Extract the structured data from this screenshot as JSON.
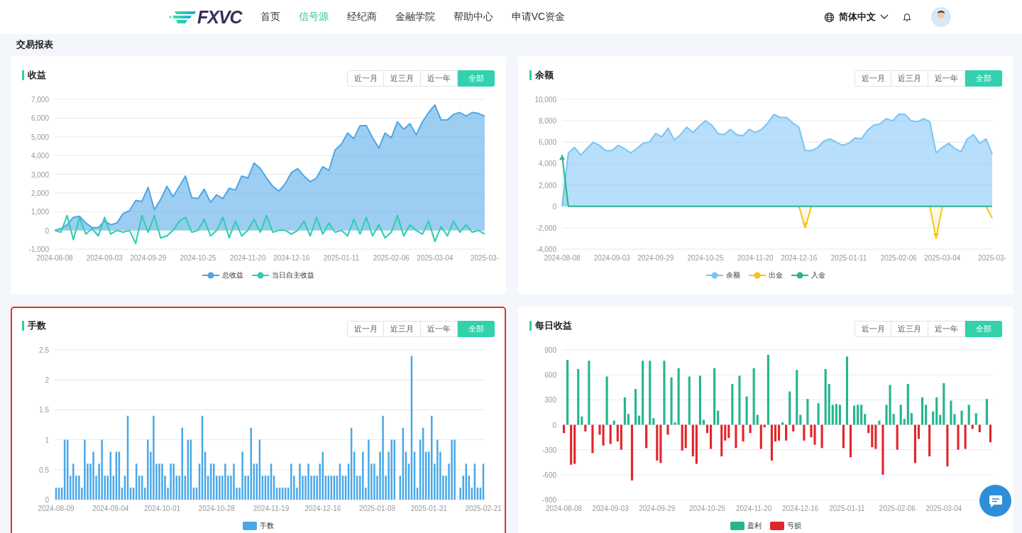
{
  "header": {
    "logo": "FXVC",
    "nav": [
      {
        "label": "首页",
        "selected": false
      },
      {
        "label": "信号源",
        "selected": true
      },
      {
        "label": "经纪商",
        "selected": false
      },
      {
        "label": "金融学院",
        "selected": false
      },
      {
        "label": "帮助中心",
        "selected": false
      },
      {
        "label": "申请VC资金",
        "selected": false
      }
    ],
    "language": "简体中文"
  },
  "page_title": "交易报表",
  "cards": [
    {
      "title": "收益",
      "highlighted": false,
      "tabs": [
        {
          "label": "近一月",
          "selected": false
        },
        {
          "label": "近三月",
          "selected": false
        },
        {
          "label": "近一年",
          "selected": false
        },
        {
          "label": "全部",
          "selected": true
        }
      ],
      "chart_data": {
        "type": "area",
        "grid": true,
        "ylim": [
          -1000,
          7000
        ],
        "yticks": [
          {
            "value": -1000,
            "label": "-1,000"
          },
          0,
          {
            "value": 1000,
            "label": "1,000"
          },
          {
            "value": 2000,
            "label": "2,000"
          },
          {
            "value": 3000,
            "label": "3,000"
          },
          {
            "value": 4000,
            "label": "4,000"
          },
          {
            "value": 5000,
            "label": "5,000"
          },
          {
            "value": 6000,
            "label": "6,000"
          },
          {
            "value": 7000,
            "label": "7,000"
          }
        ],
        "categories": [
          "2024-08-08",
          null,
          null,
          null,
          null,
          null,
          null,
          null,
          "2024-09-03",
          null,
          null,
          null,
          null,
          null,
          null,
          "2024-09-29",
          null,
          null,
          null,
          null,
          null,
          null,
          null,
          "2024-10-25",
          null,
          null,
          null,
          null,
          null,
          null,
          null,
          "2024-11-20",
          null,
          null,
          null,
          null,
          null,
          null,
          "2024-12-16",
          null,
          null,
          null,
          null,
          null,
          null,
          null,
          "2025-01-11",
          null,
          null,
          null,
          null,
          null,
          null,
          null,
          "2025-02-06",
          null,
          null,
          null,
          null,
          null,
          null,
          "2025-03-04",
          null,
          null,
          null,
          null,
          null,
          null,
          null,
          "2025-03-"
        ],
        "series": [
          {
            "name": "总收益",
            "color": "#4da6e6",
            "values": [
              0,
              100,
              300,
              700,
              750,
              400,
              150,
              150,
              500,
              300,
              400,
              900,
              1050,
              1600,
              1550,
              2300,
              1100,
              1650,
              2350,
              1800,
              2350,
              2900,
              1750,
              1700,
              2200,
              1500,
              1900,
              1700,
              2250,
              2150,
              2900,
              2800,
              3600,
              3300,
              2800,
              2350,
              2100,
              2500,
              3100,
              3300,
              2900,
              2600,
              2800,
              3400,
              3200,
              4300,
              4600,
              5200,
              4900,
              5600,
              5600,
              4950,
              4400,
              5200,
              4950,
              5800,
              5400,
              5700,
              5100,
              5800,
              6300,
              6700,
              5900,
              5900,
              6200,
              6300,
              6100,
              6300,
              6250,
              6100
            ]
          },
          {
            "name": "当日自主收益",
            "color": "#2ecdb0",
            "values": [
              0,
              -100,
              800,
              -500,
              700,
              -200,
              100,
              -300,
              700,
              -200,
              0,
              -100,
              0,
              -700,
              800,
              -100,
              800,
              -400,
              -300,
              0,
              500,
              700,
              -100,
              0,
              600,
              -300,
              0,
              700,
              -400,
              500,
              -300,
              0,
              600,
              -100,
              800,
              -100,
              0,
              0,
              -200,
              0,
              500,
              -300,
              700,
              -200,
              400,
              -100,
              0,
              -300,
              600,
              -200,
              700,
              -300,
              300,
              -400,
              -100,
              800,
              -300,
              300,
              0,
              -200,
              500,
              -600,
              200,
              -300,
              500,
              -100,
              300,
              -100,
              0,
              -200
            ]
          }
        ]
      }
    },
    {
      "title": "余额",
      "highlighted": false,
      "tabs": [
        {
          "label": "近一月",
          "selected": false
        },
        {
          "label": "近三月",
          "selected": false
        },
        {
          "label": "近一年",
          "selected": false
        },
        {
          "label": "全部",
          "selected": true
        }
      ],
      "chart_data": {
        "type": "area",
        "grid": true,
        "ylim": [
          -4000,
          10000
        ],
        "yticks": [
          {
            "value": -4000,
            "label": "-4,000"
          },
          {
            "value": -2000,
            "label": "-2,000"
          },
          0,
          {
            "value": 2000,
            "label": "2,000"
          },
          {
            "value": 4000,
            "label": "4,000"
          },
          {
            "value": 6000,
            "label": "6,000"
          },
          {
            "value": 8000,
            "label": "8,000"
          },
          {
            "value": 10000,
            "label": "10,000"
          }
        ],
        "categories": [
          "2024-08-08",
          null,
          null,
          null,
          null,
          null,
          null,
          null,
          "2024-09-03",
          null,
          null,
          null,
          null,
          null,
          null,
          "2024-09-29",
          null,
          null,
          null,
          null,
          null,
          null,
          null,
          "2024-10-25",
          null,
          null,
          null,
          null,
          null,
          null,
          null,
          "2024-11-20",
          null,
          null,
          null,
          null,
          null,
          null,
          "2024-12-16",
          null,
          null,
          null,
          null,
          null,
          null,
          null,
          "2025-01-11",
          null,
          null,
          null,
          null,
          null,
          null,
          null,
          "2025-02-06",
          null,
          null,
          null,
          null,
          null,
          null,
          "2025-03-04",
          null,
          null,
          null,
          null,
          null,
          null,
          null,
          "2025-03-"
        ],
        "series": [
          {
            "name": "余额",
            "color": "#7cc3f5",
            "values": [
              0,
              5000,
              5500,
              4800,
              5400,
              6000,
              5700,
              5200,
              5200,
              5700,
              5400,
              5000,
              5400,
              5900,
              6000,
              6800,
              6500,
              7300,
              6200,
              6700,
              7400,
              6900,
              7500,
              8000,
              7600,
              6800,
              6700,
              7200,
              6700,
              6600,
              7200,
              6900,
              7200,
              7800,
              8600,
              8300,
              8300,
              7800,
              7400,
              5200,
              5200,
              5500,
              6100,
              6300,
              6000,
              5700,
              5900,
              6400,
              6300,
              7100,
              7600,
              7700,
              8200,
              8000,
              8600,
              8600,
              8000,
              7900,
              8200,
              7900,
              5000,
              5500,
              5900,
              5400,
              5100,
              6300,
              6700,
              5900,
              6300,
              4900
            ]
          },
          {
            "name": "出金",
            "color": "#f5c518",
            "values": [
              null,
              null,
              null,
              null,
              null,
              null,
              null,
              null,
              null,
              null,
              null,
              null,
              null,
              null,
              null,
              null,
              null,
              null,
              null,
              null,
              null,
              null,
              null,
              null,
              null,
              null,
              null,
              null,
              null,
              null,
              null,
              null,
              null,
              null,
              null,
              null,
              null,
              null,
              0,
              -2000,
              0,
              null,
              null,
              null,
              null,
              null,
              null,
              null,
              null,
              null,
              null,
              null,
              null,
              null,
              null,
              null,
              null,
              null,
              null,
              0,
              -3000,
              0,
              null,
              null,
              null,
              null,
              null,
              null,
              0,
              -1100
            ]
          },
          {
            "name": "入金",
            "color": "#26b58e",
            "values": [
              4800,
              0,
              0,
              0,
              0,
              0,
              0,
              0,
              0,
              0,
              0,
              0,
              0,
              0,
              0,
              0,
              0,
              0,
              0,
              0,
              0,
              0,
              0,
              0,
              0,
              0,
              0,
              0,
              0,
              0,
              0,
              0,
              0,
              0,
              0,
              0,
              0,
              0,
              0,
              0,
              0,
              0,
              0,
              0,
              0,
              0,
              0,
              0,
              0,
              0,
              0,
              0,
              0,
              0,
              0,
              0,
              0,
              0,
              0,
              0,
              0,
              0,
              0,
              0,
              0,
              0,
              0,
              0,
              0,
              0
            ]
          }
        ]
      }
    },
    {
      "title": "手数",
      "highlighted": true,
      "tabs": [
        {
          "label": "近一月",
          "selected": false
        },
        {
          "label": "近三月",
          "selected": false
        },
        {
          "label": "近一年",
          "selected": false
        },
        {
          "label": "全部",
          "selected": true
        }
      ],
      "chart_data": {
        "type": "bar",
        "grid": true,
        "ylim": [
          0,
          2.5
        ],
        "yticks": [
          0,
          0.5,
          1,
          1.5,
          2,
          2.5
        ],
        "categories": [
          "2024-08-09",
          null,
          null,
          null,
          null,
          null,
          null,
          null,
          null,
          null,
          null,
          null,
          null,
          null,
          null,
          null,
          null,
          null,
          null,
          "2024-09-04",
          null,
          null,
          null,
          null,
          null,
          null,
          null,
          null,
          null,
          null,
          null,
          null,
          null,
          null,
          null,
          null,
          null,
          "2024-10-01",
          null,
          null,
          null,
          null,
          null,
          null,
          null,
          null,
          null,
          null,
          null,
          null,
          null,
          null,
          null,
          null,
          null,
          null,
          "2024-10-28",
          null,
          null,
          null,
          null,
          null,
          null,
          null,
          null,
          null,
          null,
          null,
          null,
          null,
          null,
          null,
          null,
          null,
          null,
          "2024-11-19",
          null,
          null,
          null,
          null,
          null,
          null,
          null,
          null,
          null,
          null,
          null,
          null,
          null,
          null,
          null,
          null,
          null,
          "2024-12-16",
          null,
          null,
          null,
          null,
          null,
          null,
          null,
          null,
          null,
          null,
          null,
          null,
          null,
          null,
          null,
          null,
          null,
          null,
          "2025-01-09",
          null,
          null,
          null,
          null,
          null,
          null,
          null,
          null,
          null,
          null,
          null,
          null,
          null,
          null,
          null,
          null,
          null,
          "2025-01-31",
          null,
          null,
          null,
          null,
          null,
          null,
          null,
          null,
          null,
          null,
          null,
          null,
          null,
          null,
          null,
          null,
          null,
          null,
          "2025-02-21"
        ],
        "series": [
          {
            "name": "手数",
            "color": "#4aa8e8",
            "values": [
              0.2,
              0.2,
              0.2,
              1,
              1,
              0.4,
              0.6,
              0.4,
              0.4,
              0.2,
              1,
              0.6,
              0.6,
              0.8,
              0.4,
              0.6,
              1,
              0.4,
              0.4,
              0.8,
              0.4,
              0.8,
              0.8,
              0.2,
              0.4,
              1.4,
              0.2,
              0.2,
              0.6,
              0.4,
              0.4,
              0.2,
              1,
              0.8,
              1.4,
              0.6,
              0.6,
              0.6,
              0.4,
              0.2,
              0.6,
              0.6,
              0.4,
              0.4,
              1.2,
              0.4,
              1,
              1,
              0.2,
              0.2,
              0.6,
              1.4,
              0.8,
              0.4,
              0.6,
              0.6,
              0.4,
              0.4,
              0.4,
              0.6,
              0.4,
              0.4,
              0.6,
              0.2,
              0.2,
              0.8,
              0.4,
              0.4,
              1.2,
              0.6,
              0.6,
              1,
              0.4,
              0.4,
              0.4,
              0.6,
              0.4,
              0.2,
              0.2,
              0.2,
              0.2,
              0.2,
              0.6,
              0.4,
              0.2,
              0.6,
              0.4,
              0.4,
              0.6,
              0.4,
              0.4,
              0.4,
              0.6,
              0.8,
              0.4,
              0.4,
              0.4,
              0.4,
              0.4,
              0.6,
              0.4,
              0.4,
              0.6,
              1.2,
              0.8,
              0.4,
              0.4,
              0.8,
              0.2,
              1,
              0.6,
              0.6,
              0.4,
              0.8,
              1.4,
              0.4,
              0.8,
              1,
              1,
              null,
              0.4,
              1.2,
              0.8,
              0.6,
              2.4,
              0.8,
              0.2,
              1,
              1.2,
              0.8,
              0.8,
              1.4,
              0.6,
              1,
              0.8,
              0.4,
              0.4,
              0.6,
              1,
              1,
              null,
              0.2,
              0.4,
              0.6,
              0.4,
              0.2,
              0.6,
              0.2,
              0.2,
              0.6
            ]
          }
        ]
      }
    },
    {
      "title": "每日收益",
      "highlighted": false,
      "tabs": [
        {
          "label": "近一月",
          "selected": false
        },
        {
          "label": "近三月",
          "selected": false
        },
        {
          "label": "近一年",
          "selected": false
        },
        {
          "label": "全部",
          "selected": true
        }
      ],
      "chart_data": {
        "type": "bar",
        "grid": true,
        "ylim": [
          -900,
          900
        ],
        "yticks": [
          -900,
          -600,
          -300,
          0,
          300,
          600,
          900
        ],
        "categories": [
          "2024-08-08",
          null,
          null,
          null,
          null,
          null,
          null,
          null,
          null,
          null,
          null,
          null,
          null,
          "2024-09-03",
          null,
          null,
          null,
          null,
          null,
          null,
          null,
          null,
          null,
          null,
          null,
          null,
          "2024-09-29",
          null,
          null,
          null,
          null,
          null,
          null,
          null,
          null,
          null,
          null,
          null,
          null,
          null,
          "2024-10-25",
          null,
          null,
          null,
          null,
          null,
          null,
          null,
          null,
          null,
          null,
          null,
          null,
          "2024-11-20",
          null,
          null,
          null,
          null,
          null,
          null,
          null,
          null,
          null,
          null,
          null,
          null,
          "2024-12-16",
          null,
          null,
          null,
          null,
          null,
          null,
          null,
          null,
          null,
          null,
          null,
          null,
          "2025-01-11",
          null,
          null,
          null,
          null,
          null,
          null,
          null,
          null,
          null,
          null,
          null,
          null,
          null,
          "2025-02-06",
          null,
          null,
          null,
          null,
          null,
          null,
          null,
          null,
          null,
          null,
          null,
          null,
          "2025-03-04",
          null,
          null,
          null,
          null,
          null,
          null,
          null,
          null,
          null,
          null,
          null,
          null,
          null
        ],
        "series": [
          {
            "name": "盈利",
            "color": "#26b58e",
            "values": [
              null,
              780,
              null,
              null,
              670,
              100,
              null,
              770,
              null,
              null,
              null,
              null,
              580,
              null,
              50,
              null,
              null,
              330,
              130,
              null,
              430,
              110,
              770,
              null,
              770,
              80,
              null,
              null,
              770,
              null,
              570,
              30,
              680,
              null,
              null,
              580,
              null,
              null,
              590,
              60,
              null,
              null,
              680,
              170,
              null,
              null,
              null,
              490,
              null,
              590,
              null,
              340,
              null,
              680,
              120,
              null,
              null,
              840,
              null,
              null,
              null,
              30,
              null,
              400,
              null,
              660,
              120,
              null,
              310,
              null,
              null,
              260,
              null,
              670,
              490,
              240,
              250,
              240,
              null,
              820,
              null,
              230,
              240,
              240,
              130,
              null,
              null,
              null,
              50,
              null,
              240,
              480,
              130,
              null,
              240,
              70,
              490,
              140,
              null,
              null,
              330,
              240,
              null,
              160,
              330,
              120,
              500,
              null,
              290,
              130,
              null,
              170,
              null,
              240,
              null,
              140,
              null,
              null,
              310,
              null
            ]
          },
          {
            "name": "亏损",
            "color": "#e0262b",
            "values": [
              -100,
              null,
              -480,
              -470,
              null,
              null,
              -80,
              null,
              -340,
              null,
              -120,
              -250,
              null,
              -230,
              null,
              -200,
              -300,
              null,
              null,
              -670,
              null,
              null,
              null,
              -280,
              null,
              null,
              -430,
              -460,
              null,
              -120,
              null,
              null,
              null,
              -310,
              -280,
              null,
              -380,
              -470,
              null,
              null,
              -100,
              -290,
              null,
              null,
              -380,
              -190,
              -160,
              null,
              -280,
              null,
              -200,
              null,
              -100,
              null,
              null,
              -290,
              -30,
              null,
              -430,
              -200,
              -190,
              null,
              -190,
              null,
              -80,
              null,
              null,
              -190,
              null,
              -150,
              -240,
              null,
              -280,
              null,
              null,
              null,
              null,
              null,
              -280,
              null,
              -390,
              null,
              null,
              null,
              null,
              -100,
              -270,
              -290,
              null,
              -600,
              null,
              null,
              null,
              -300,
              null,
              null,
              null,
              null,
              -460,
              -170,
              null,
              null,
              -380,
              null,
              null,
              null,
              null,
              -500,
              null,
              null,
              -300,
              null,
              -290,
              null,
              -50,
              null,
              -90,
              null,
              null,
              -210
            ]
          }
        ]
      }
    }
  ]
}
